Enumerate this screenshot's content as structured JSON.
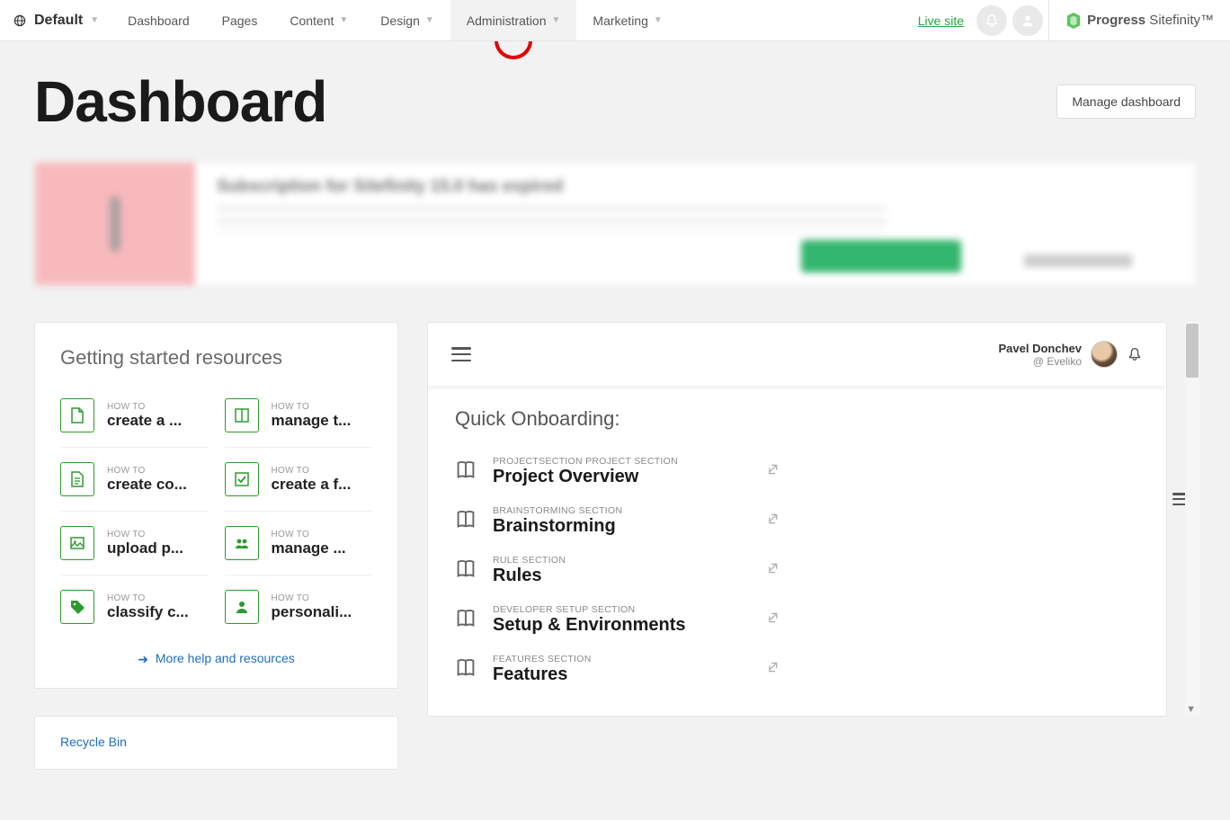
{
  "topbar": {
    "site_label": "Default",
    "nav": [
      {
        "label": "Dashboard",
        "has_caret": false,
        "active": false
      },
      {
        "label": "Pages",
        "has_caret": false,
        "active": false
      },
      {
        "label": "Content",
        "has_caret": true,
        "active": false
      },
      {
        "label": "Design",
        "has_caret": true,
        "active": false
      },
      {
        "label": "Administration",
        "has_caret": true,
        "active": true
      },
      {
        "label": "Marketing",
        "has_caret": true,
        "active": false
      }
    ],
    "live_site": "Live site",
    "brand": {
      "bold": "Progress",
      "light": " Sitefinity"
    }
  },
  "page": {
    "title": "Dashboard",
    "manage_btn": "Manage dashboard"
  },
  "banner": {
    "title": "Subscription for Sitefinity 15.0 has expired"
  },
  "getting_started": {
    "title": "Getting started resources",
    "howto": "HOW TO",
    "items": [
      {
        "name": "create a ...",
        "icon": "file"
      },
      {
        "name": "manage t...",
        "icon": "layout"
      },
      {
        "name": "create co...",
        "icon": "doc"
      },
      {
        "name": "create a f...",
        "icon": "check"
      },
      {
        "name": "upload p...",
        "icon": "image"
      },
      {
        "name": "manage ...",
        "icon": "users"
      },
      {
        "name": "classify c...",
        "icon": "tag"
      },
      {
        "name": "personali...",
        "icon": "person"
      }
    ],
    "more": "More help and resources"
  },
  "recycle": {
    "label": "Recycle Bin"
  },
  "onboarding": {
    "user": {
      "name": "Pavel Donchev",
      "org": "@ Eveliko"
    },
    "title": "Quick Onboarding:",
    "items": [
      {
        "section": "PROJECTSECTION PROJECT SECTION",
        "name": "Project Overview"
      },
      {
        "section": "BRAINSTORMING SECTION",
        "name": "Brainstorming"
      },
      {
        "section": "RULE SECTION",
        "name": "Rules"
      },
      {
        "section": "DEVELOPER SETUP SECTION",
        "name": "Setup & Environments"
      },
      {
        "section": "FEATURES SECTION",
        "name": "Features"
      }
    ]
  }
}
